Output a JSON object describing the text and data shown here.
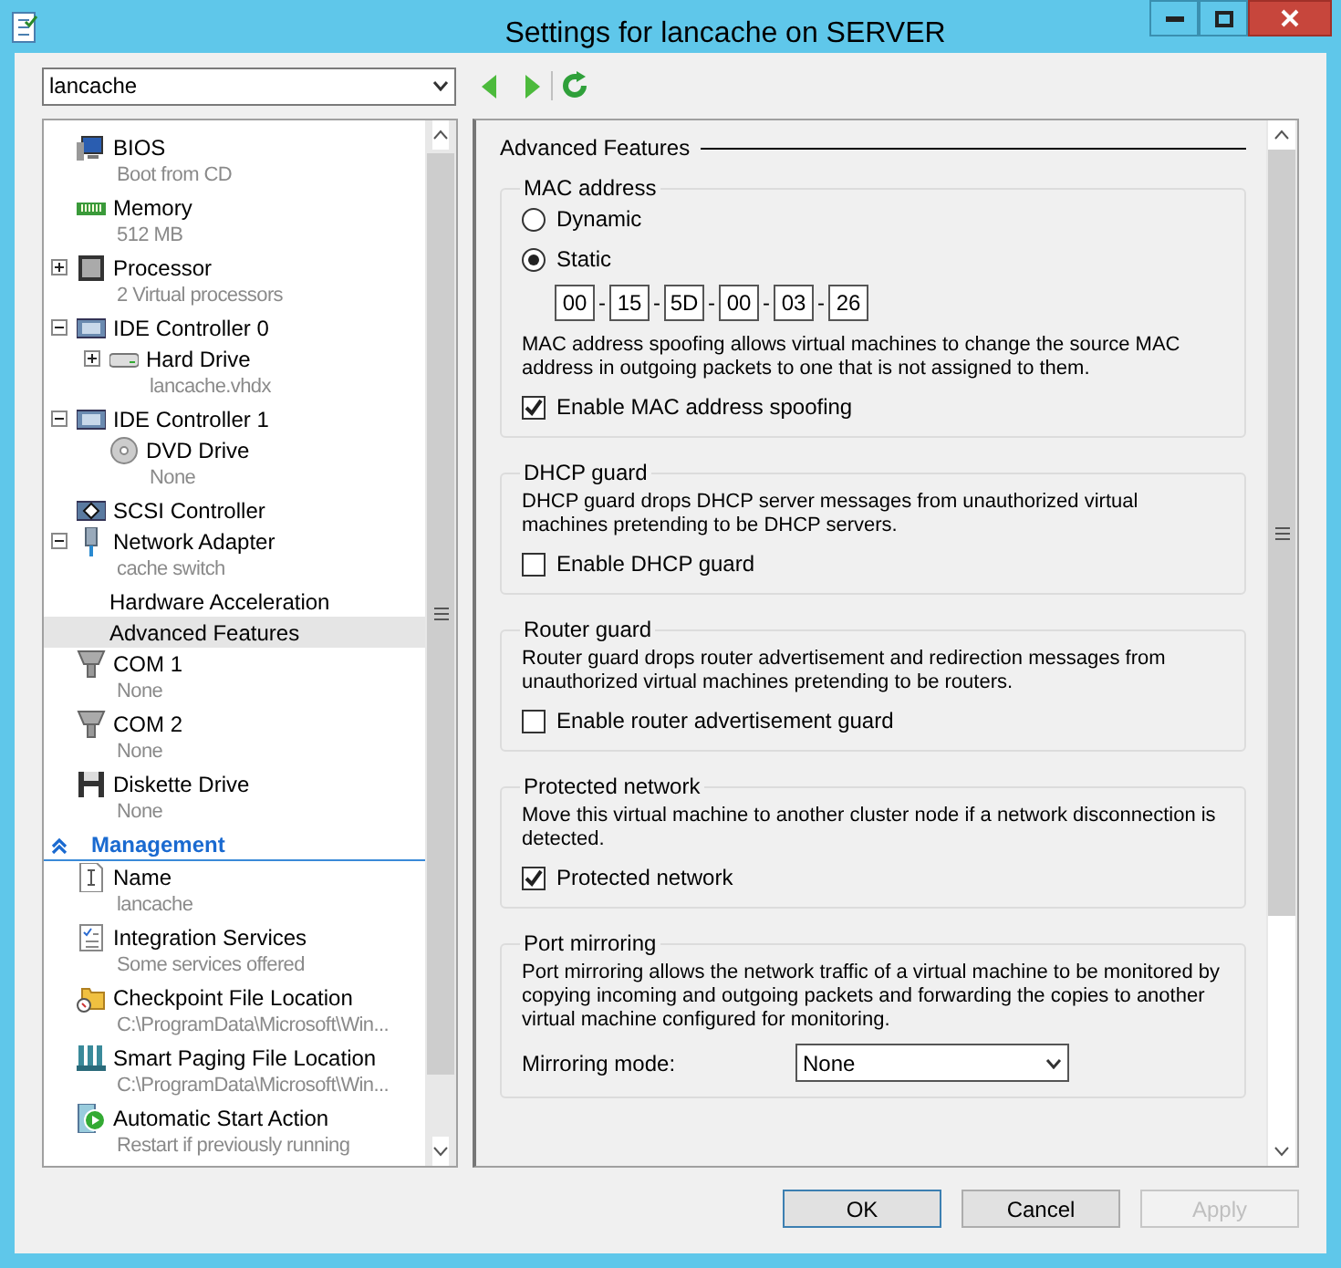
{
  "window": {
    "title": "Settings for lancache on SERVER"
  },
  "vm_selector": {
    "value": "lancache"
  },
  "hardware": [
    {
      "name": "BIOS",
      "sub": "Boot from CD",
      "kind": "bios",
      "selected": false
    },
    {
      "name": "Memory",
      "sub": "512 MB",
      "kind": "memory",
      "selected": false
    },
    {
      "name": "Processor",
      "sub": "2 Virtual processors",
      "kind": "processor",
      "expanded": false,
      "selected": false
    },
    {
      "name": "IDE Controller 0",
      "kind": "controller",
      "expanded": true,
      "selected": false,
      "children": [
        {
          "name": "Hard Drive",
          "sub": "lancache.vhdx",
          "kind": "disk",
          "expanded": false,
          "selected": false
        }
      ]
    },
    {
      "name": "IDE Controller 1",
      "kind": "controller",
      "expanded": true,
      "selected": false,
      "children": [
        {
          "name": "DVD Drive",
          "sub": "None",
          "kind": "dvd",
          "selected": false
        }
      ]
    },
    {
      "name": "SCSI Controller",
      "kind": "scsi",
      "selected": false
    },
    {
      "name": "Network Adapter",
      "sub": "cache switch",
      "kind": "network",
      "expanded": true,
      "selected": false,
      "children": [
        {
          "name": "Hardware Acceleration",
          "kind": "none",
          "selected": false
        },
        {
          "name": "Advanced Features",
          "kind": "none",
          "selected": true
        }
      ]
    },
    {
      "name": "COM 1",
      "sub": "None",
      "kind": "serial",
      "selected": false
    },
    {
      "name": "COM 2",
      "sub": "None",
      "kind": "serial",
      "selected": false
    },
    {
      "name": "Diskette Drive",
      "sub": "None",
      "kind": "floppy",
      "selected": false
    }
  ],
  "management": {
    "title": "Management",
    "expanded": true,
    "items": [
      {
        "name": "Name",
        "sub": "lancache",
        "kind": "name",
        "selected": false
      },
      {
        "name": "Integration Services",
        "sub": "Some services offered",
        "kind": "services",
        "selected": false
      },
      {
        "name": "Checkpoint File Location",
        "sub": "C:\\ProgramData\\Microsoft\\Win...",
        "kind": "folder",
        "selected": false
      },
      {
        "name": "Smart Paging File Location",
        "sub": "C:\\ProgramData\\Microsoft\\Win...",
        "kind": "paging",
        "selected": false
      },
      {
        "name": "Automatic Start Action",
        "sub": "Restart if previously running",
        "kind": "start",
        "selected": false
      }
    ]
  },
  "details": {
    "title": "Advanced Features",
    "groups": [
      {
        "legend": "MAC address",
        "controls": [
          {
            "kind": "radio",
            "label": "Dynamic",
            "selected": false
          },
          {
            "kind": "radio",
            "label": "Static",
            "selected": true
          },
          {
            "kind": "mac",
            "separator": "-",
            "octets": [
              "00",
              "15",
              "5D",
              "00",
              "03",
              "26"
            ]
          },
          {
            "kind": "text",
            "text": "MAC address spoofing allows virtual machines to change the source MAC address in outgoing packets to one that is not assigned to them."
          },
          {
            "kind": "checkbox",
            "label": "Enable MAC address spoofing",
            "checked": true
          }
        ]
      },
      {
        "legend": "DHCP guard",
        "controls": [
          {
            "kind": "text",
            "text": "DHCP guard drops DHCP server messages from unauthorized virtual machines pretending to be DHCP servers."
          },
          {
            "kind": "checkbox",
            "label": "Enable DHCP guard",
            "checked": false
          }
        ]
      },
      {
        "legend": "Router guard",
        "controls": [
          {
            "kind": "text",
            "text": "Router guard drops router advertisement and redirection messages from unauthorized virtual machines pretending to be routers."
          },
          {
            "kind": "checkbox",
            "label": "Enable router advertisement guard",
            "checked": false
          }
        ]
      },
      {
        "legend": "Protected network",
        "controls": [
          {
            "kind": "text",
            "text": "Move this virtual machine to another cluster node if a network disconnection is detected."
          },
          {
            "kind": "checkbox",
            "label": "Protected network",
            "checked": true
          }
        ]
      },
      {
        "legend": "Port mirroring",
        "controls": [
          {
            "kind": "text",
            "text": "Port mirroring allows the network traffic of a virtual machine to be monitored by copying incoming and outgoing packets and forwarding the copies to another virtual machine configured for monitoring."
          },
          {
            "kind": "select",
            "label": "Mirroring mode:",
            "value": "None"
          }
        ]
      }
    ]
  },
  "buttons": [
    {
      "label": "OK",
      "kind": "default",
      "disabled": false
    },
    {
      "label": "Cancel",
      "kind": "normal",
      "disabled": false
    },
    {
      "label": "Apply",
      "kind": "normal",
      "disabled": true
    }
  ]
}
